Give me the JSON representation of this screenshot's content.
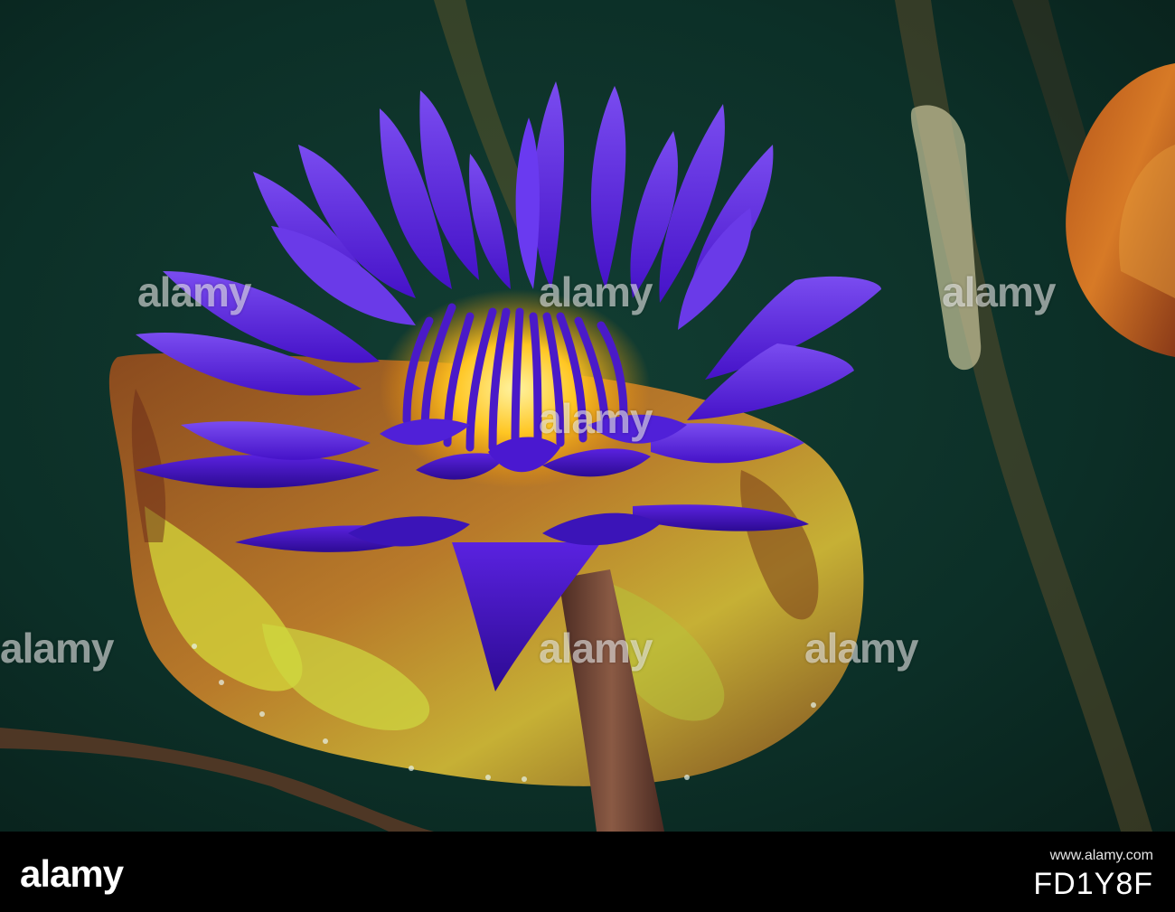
{
  "photo": {
    "subject": "blue water lily",
    "colors": {
      "water": "#0f3a30",
      "petal": "#5a1fe0",
      "petal_dark": "#3a0fa8",
      "center": "#ffd23a",
      "pad_orange": "#c96a22",
      "pad_yellow": "#c9d43a",
      "stem": "#6b3a2a"
    }
  },
  "watermark": {
    "text": "alamy"
  },
  "footer": {
    "logo": "alamy",
    "caption": "www.alamy.com",
    "image_id": "FD1Y8F"
  }
}
